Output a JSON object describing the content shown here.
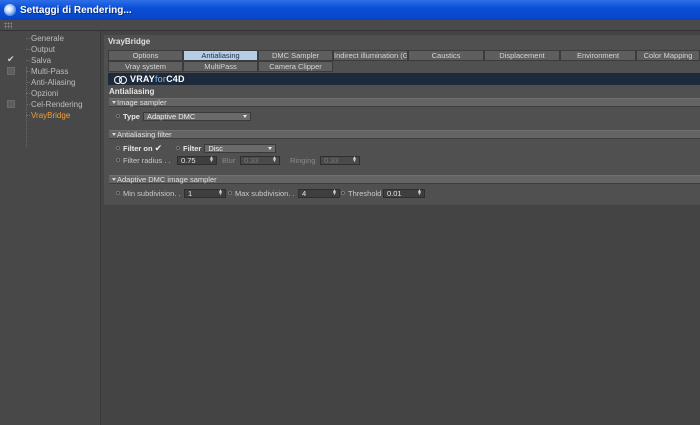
{
  "window": {
    "title": "Settaggi di Rendering..."
  },
  "sidebar": {
    "items": [
      {
        "label": "Generale",
        "check": "none",
        "active": false
      },
      {
        "label": "Output",
        "check": "none",
        "active": false
      },
      {
        "label": "Salva",
        "check": "checked",
        "active": false
      },
      {
        "label": "Multi-Pass",
        "check": "box",
        "active": false
      },
      {
        "label": "Anti-Aliasing",
        "check": "none",
        "active": false
      },
      {
        "label": "Opzioni",
        "check": "none",
        "active": false
      },
      {
        "label": "Cel-Rendering",
        "check": "box",
        "active": false
      },
      {
        "label": "VrayBridge",
        "check": "none",
        "active": true
      }
    ]
  },
  "panel": {
    "title": "VrayBridge",
    "tabs_row1": [
      "Options",
      "Antialiasing",
      "DMC Sampler",
      "Indirect illumination (GI)",
      "Caustics",
      "Displacement",
      "Environment",
      "Color Mapping"
    ],
    "tabs_row2": [
      "Vray system",
      "MultiPass",
      "Camera Clipper"
    ],
    "active_tab": "Antialiasing",
    "logo": {
      "main": "VRAY",
      "for": "for",
      "c4d": "C4D"
    },
    "section_title": "Antialiasing"
  },
  "image_sampler": {
    "group_label": "Image sampler",
    "type_label": "Type",
    "type_value": "Adaptive DMC"
  },
  "aa_filter": {
    "group_label": "Antialiasing filter",
    "filter_on_label": "Filter on",
    "filter_on_mark": "✔",
    "filter_label": "Filter",
    "filter_value": "Disc",
    "radius_label": "Filter radius . .",
    "radius_value": "0.75",
    "blur_label": "Blur",
    "blur_value": "0.33",
    "ringing_label": "Ringing",
    "ringing_value": "0.33"
  },
  "dmc": {
    "group_label": "Adaptive DMC image sampler",
    "min_label": "Min subdivision. . . .",
    "min_value": "1",
    "max_label": "Max subdivision. . . .",
    "max_value": "4",
    "threshold_label": "Threshold",
    "threshold_value": "0.01"
  },
  "colors": {
    "active_tab": "#b7cde6",
    "active_nav": "#f0a03c",
    "titlebar": "#0a4fd8"
  }
}
